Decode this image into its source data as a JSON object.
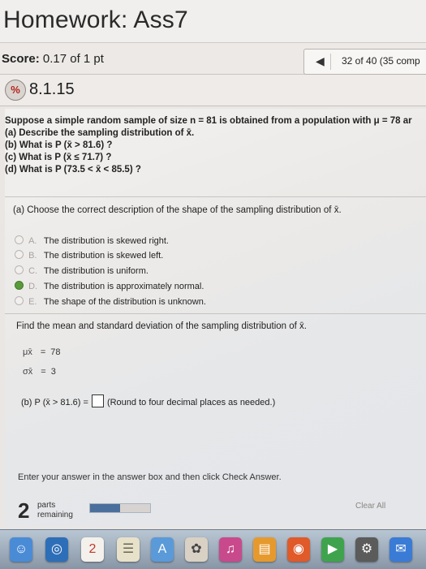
{
  "header": {
    "title": "Homework: Ass7"
  },
  "scorebar": {
    "score_label": "Score:",
    "score_value": "0.17 of 1 pt",
    "nav_prev": "◀",
    "position": "32 of 40 (35 comp"
  },
  "question": {
    "badge": "%",
    "number": "8.1.15",
    "intro": "Suppose a simple random sample of size n = 81 is obtained from a population with μ = 78 ar",
    "parts": [
      "(a) Describe the sampling distribution of x̄.",
      "(b) What is P (x̄ > 81.6) ?",
      "(c) What is P (x̄ ≤ 71.7) ?",
      "(d) What is P (73.5 < x̄ < 85.5) ?"
    ]
  },
  "part_a": {
    "prompt": "(a) Choose the correct description of the shape of the sampling distribution of x̄.",
    "options": [
      {
        "letter": "A.",
        "text": "The distribution is skewed right."
      },
      {
        "letter": "B.",
        "text": "The distribution is skewed left."
      },
      {
        "letter": "C.",
        "text": "The distribution is uniform."
      },
      {
        "letter": "D.",
        "text": "The distribution is approximately normal."
      },
      {
        "letter": "E.",
        "text": "The shape of the distribution is unknown."
      }
    ],
    "selected": "D."
  },
  "mean_sd": {
    "prompt": "Find the mean and standard deviation of the sampling distribution of x̄.",
    "mu_symbol": "μx̄",
    "mu_value": "78",
    "sigma_symbol": "σx̄",
    "sigma_value": "3"
  },
  "part_b": {
    "prompt": "(b) P (x̄ > 81.6) =",
    "hint": "(Round to four decimal places as needed.)"
  },
  "footer": {
    "instruction": "Enter your answer in the answer box and then click Check Answer.",
    "parts_count": "2",
    "parts_label_1": "parts",
    "parts_label_2": "remaining",
    "progress_fraction": 0.5,
    "clear_all": "Clear All"
  },
  "dock": {
    "icons": [
      "finder-icon",
      "calendar-icon",
      "notes-icon",
      "app-store-icon",
      "photos-icon",
      "itunes-icon",
      "ibooks-icon",
      "system-preferences-icon",
      "chrome-icon",
      "firefox-icon",
      "facetime-icon",
      "messages-icon"
    ],
    "calendar_day": "2",
    "colors": {
      "accent": "#4b6f9c",
      "selected_radio": "#5a9a3d",
      "badge_x": "#b3221b"
    }
  }
}
